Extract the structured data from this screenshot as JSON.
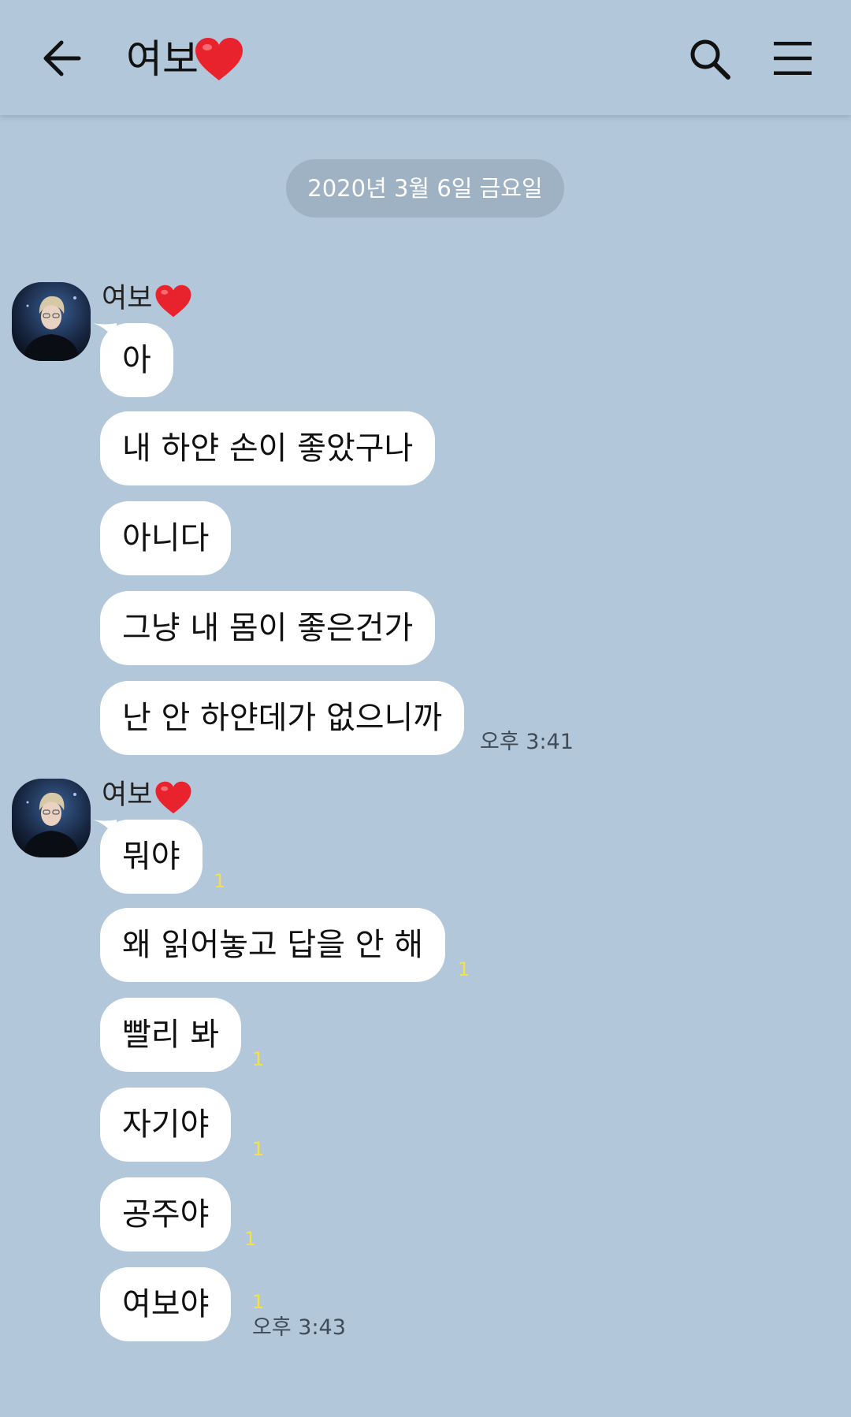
{
  "header": {
    "title": "여보",
    "back_icon": "arrow-left-icon",
    "search_icon": "search-icon",
    "menu_icon": "hamburger-menu-icon"
  },
  "date_divider": "2020년 3월 6일 금요일",
  "groups": [
    {
      "sender": "여보",
      "messages": [
        {
          "text": "아"
        },
        {
          "text": "내 하얀 손이 좋았구나"
        },
        {
          "text": "아니다"
        },
        {
          "text": "그냥 내 몸이 좋은건가"
        },
        {
          "text": "난 안 하얀데가 없으니까"
        }
      ],
      "time": "오후 3:41"
    },
    {
      "sender": "여보",
      "messages": [
        {
          "text": "뭐야",
          "unread": "1"
        },
        {
          "text": "왜 읽어놓고 답을 안 해",
          "unread": "1"
        },
        {
          "text": "빨리 봐",
          "unread": "1"
        },
        {
          "text": "자기야",
          "unread": "1"
        },
        {
          "text": "공주야",
          "unread": "1"
        },
        {
          "text": "여보야",
          "unread": "1"
        }
      ],
      "time": "오후 3:43"
    }
  ],
  "colors": {
    "background": "#b2c7da",
    "bubble": "#ffffff",
    "date_pill": "#9fb2c4",
    "unread": "#f5e146"
  }
}
